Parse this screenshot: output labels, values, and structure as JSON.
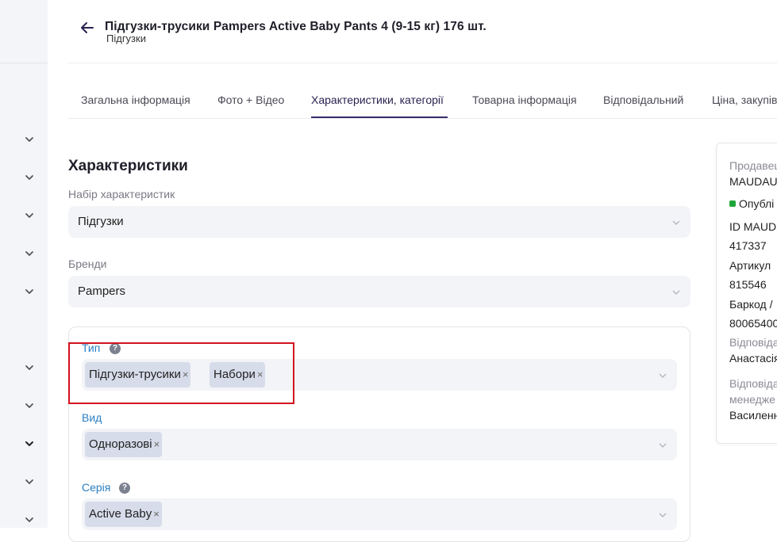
{
  "header": {
    "title": "Підгузки-трусики Pampers Active Baby Pants 4 (9-15 кг) 176 шт.",
    "subtitle": "Підгузки"
  },
  "tabs": [
    {
      "label": "Загальна інформація"
    },
    {
      "label": "Фото + Відео"
    },
    {
      "label": "Характеристики, категорії",
      "active": true
    },
    {
      "label": "Товарна інформація"
    },
    {
      "label": "Відповідальний"
    },
    {
      "label": "Ціна, закупів"
    }
  ],
  "characteristics": {
    "title": "Характеристики",
    "set_label": "Набір характеристик",
    "set_value": "Підгузки",
    "brands_label": "Бренди",
    "brands_value": "Pampers",
    "type_label": "Тип",
    "type_chips": [
      "Підгузки-трусики",
      "Набори"
    ],
    "kind_label": "Вид",
    "kind_chips": [
      "Одноразові"
    ],
    "series_label": "Серія",
    "series_chips": [
      "Active Baby"
    ],
    "remove_glyph": "×"
  },
  "info_panel": {
    "seller_label": "Продавец",
    "seller_value": "MAUDAU",
    "status": "Опублі",
    "id_label": "ID MAUD",
    "id_value": "417337",
    "article_label": "Артикул",
    "article_value": "815546",
    "barcode_label": "Баркод /",
    "barcode_value": "80065400",
    "responsible_label": "Відповіда",
    "responsible_value": "Анастасія",
    "manager_label_1": "Відповіда",
    "manager_label_2": "менедже",
    "manager_value": "Василенн"
  },
  "colors": {
    "accent": "#3a2d6b",
    "link": "#2a7fc4",
    "highlight": "#d2141e",
    "status_green": "#1fa53a"
  },
  "icons": {
    "back": "arrow-left-icon",
    "chevron": "chevron-down-icon",
    "help": "question-circle-icon"
  }
}
